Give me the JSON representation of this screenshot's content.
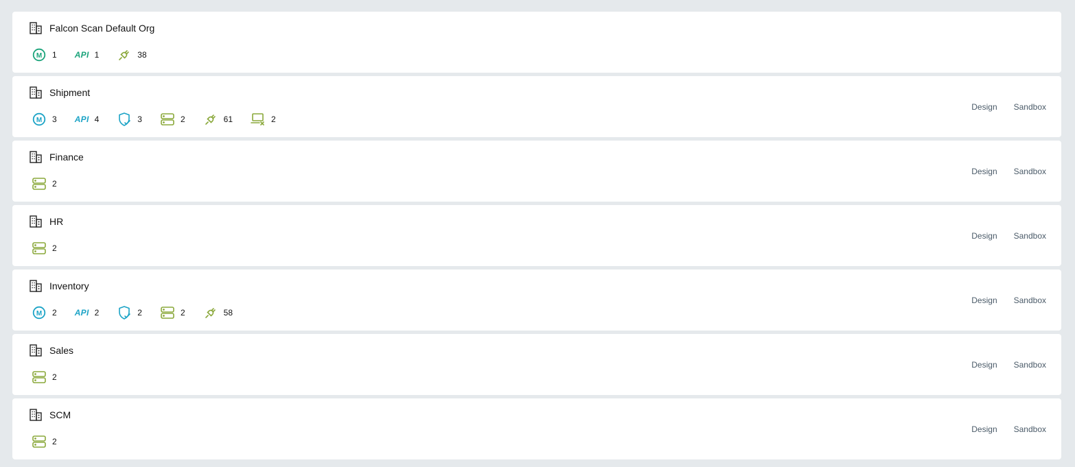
{
  "colors": {
    "background": "#e5e9ec",
    "card": "#ffffff",
    "green": "#1aa37a",
    "teal": "#1ba3c6",
    "olive": "#8aa83a",
    "link": "#4a5a68"
  },
  "orgs": [
    {
      "name": "Falcon Scan Default Org",
      "accent": "green",
      "stats": [
        {
          "icon": "m-circle-icon",
          "label": "M",
          "count": "1"
        },
        {
          "icon": "api-icon",
          "label": "API",
          "count": "1"
        },
        {
          "icon": "plug-icon",
          "count": "38"
        }
      ],
      "actions": []
    },
    {
      "name": "Shipment",
      "accent": "teal",
      "stats": [
        {
          "icon": "m-circle-icon",
          "label": "M",
          "count": "3"
        },
        {
          "icon": "api-icon",
          "label": "API",
          "count": "4"
        },
        {
          "icon": "shield-check-icon",
          "count": "3"
        },
        {
          "icon": "server-icon",
          "count": "2"
        },
        {
          "icon": "plug-icon",
          "count": "61"
        },
        {
          "icon": "disconnected-terminal-icon",
          "count": "2"
        }
      ],
      "actions": [
        "Design",
        "Sandbox"
      ]
    },
    {
      "name": "Finance",
      "accent": "teal",
      "stats": [
        {
          "icon": "server-icon",
          "count": "2"
        }
      ],
      "actions": [
        "Design",
        "Sandbox"
      ]
    },
    {
      "name": "HR",
      "accent": "teal",
      "stats": [
        {
          "icon": "server-icon",
          "count": "2"
        }
      ],
      "actions": [
        "Design",
        "Sandbox"
      ]
    },
    {
      "name": "Inventory",
      "accent": "teal",
      "stats": [
        {
          "icon": "m-circle-icon",
          "label": "M",
          "count": "2"
        },
        {
          "icon": "api-icon",
          "label": "API",
          "count": "2"
        },
        {
          "icon": "shield-check-icon",
          "count": "2"
        },
        {
          "icon": "server-icon",
          "count": "2"
        },
        {
          "icon": "plug-icon",
          "count": "58"
        }
      ],
      "actions": [
        "Design",
        "Sandbox"
      ]
    },
    {
      "name": "Sales",
      "accent": "teal",
      "stats": [
        {
          "icon": "server-icon",
          "count": "2"
        }
      ],
      "actions": [
        "Design",
        "Sandbox"
      ]
    },
    {
      "name": "SCM",
      "accent": "teal",
      "stats": [
        {
          "icon": "server-icon",
          "count": "2"
        }
      ],
      "actions": [
        "Design",
        "Sandbox"
      ]
    }
  ]
}
